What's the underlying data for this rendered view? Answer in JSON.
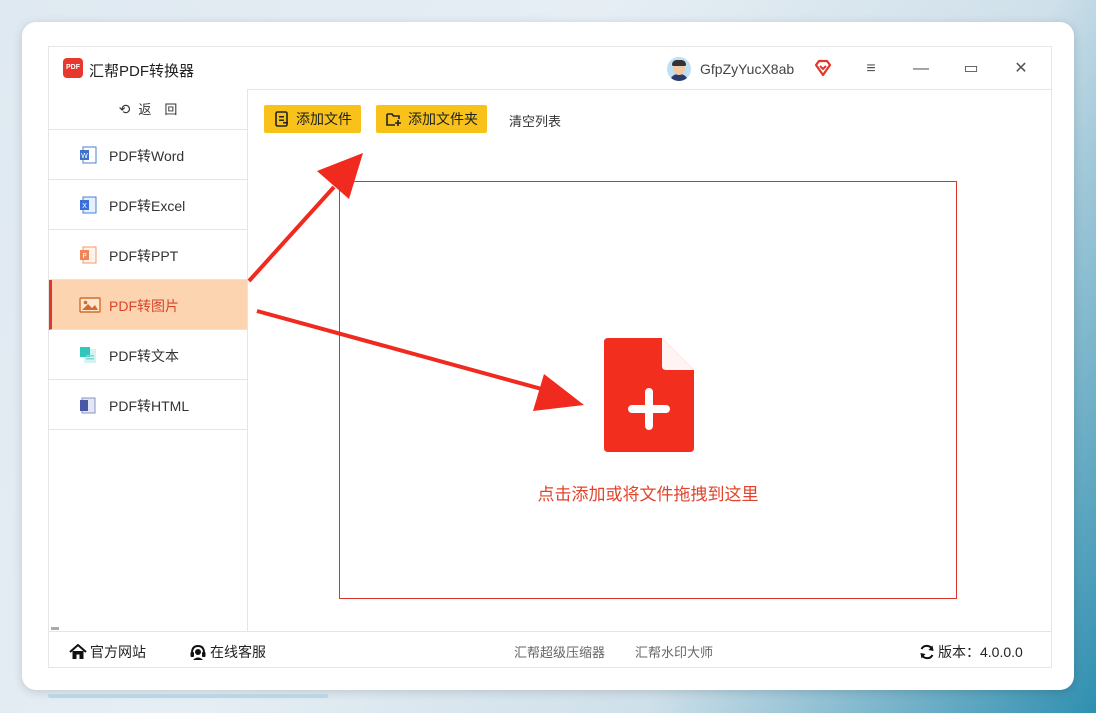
{
  "window": {
    "title": "汇帮PDF转换器",
    "logo_text": "PDF",
    "username": "GfpZyYucX8ab",
    "menu_glyph": "≡",
    "minimize_glyph": "—",
    "maximize_glyph": "▭",
    "close_glyph": "✕"
  },
  "sidebar": {
    "back_label": "返　回",
    "items": [
      {
        "label": "PDF转Word",
        "icon": "word-icon",
        "active": false
      },
      {
        "label": "PDF转Excel",
        "icon": "excel-icon",
        "active": false
      },
      {
        "label": "PDF转PPT",
        "icon": "ppt-icon",
        "active": false
      },
      {
        "label": "PDF转图片",
        "icon": "image-icon",
        "active": true
      },
      {
        "label": "PDF转文本",
        "icon": "text-icon",
        "active": false
      },
      {
        "label": "PDF转HTML",
        "icon": "html-icon",
        "active": false
      }
    ]
  },
  "toolbar": {
    "add_file_label": "添加文件",
    "add_folder_label": "添加文件夹",
    "clear_list_label": "清空列表"
  },
  "dropzone": {
    "hint": "点击添加或将文件拖拽到这里"
  },
  "footer": {
    "website_label": "官方网站",
    "support_label": "在线客服",
    "compressor_label": "汇帮超级压缩器",
    "watermark_label": "汇帮水印大师",
    "version_label": "版本：4.0.0.0"
  },
  "colors": {
    "accent": "#f8c21a",
    "brand_red": "#e1372a",
    "active_bg": "#fdd4b0",
    "arrow_red": "#f02a1e"
  }
}
